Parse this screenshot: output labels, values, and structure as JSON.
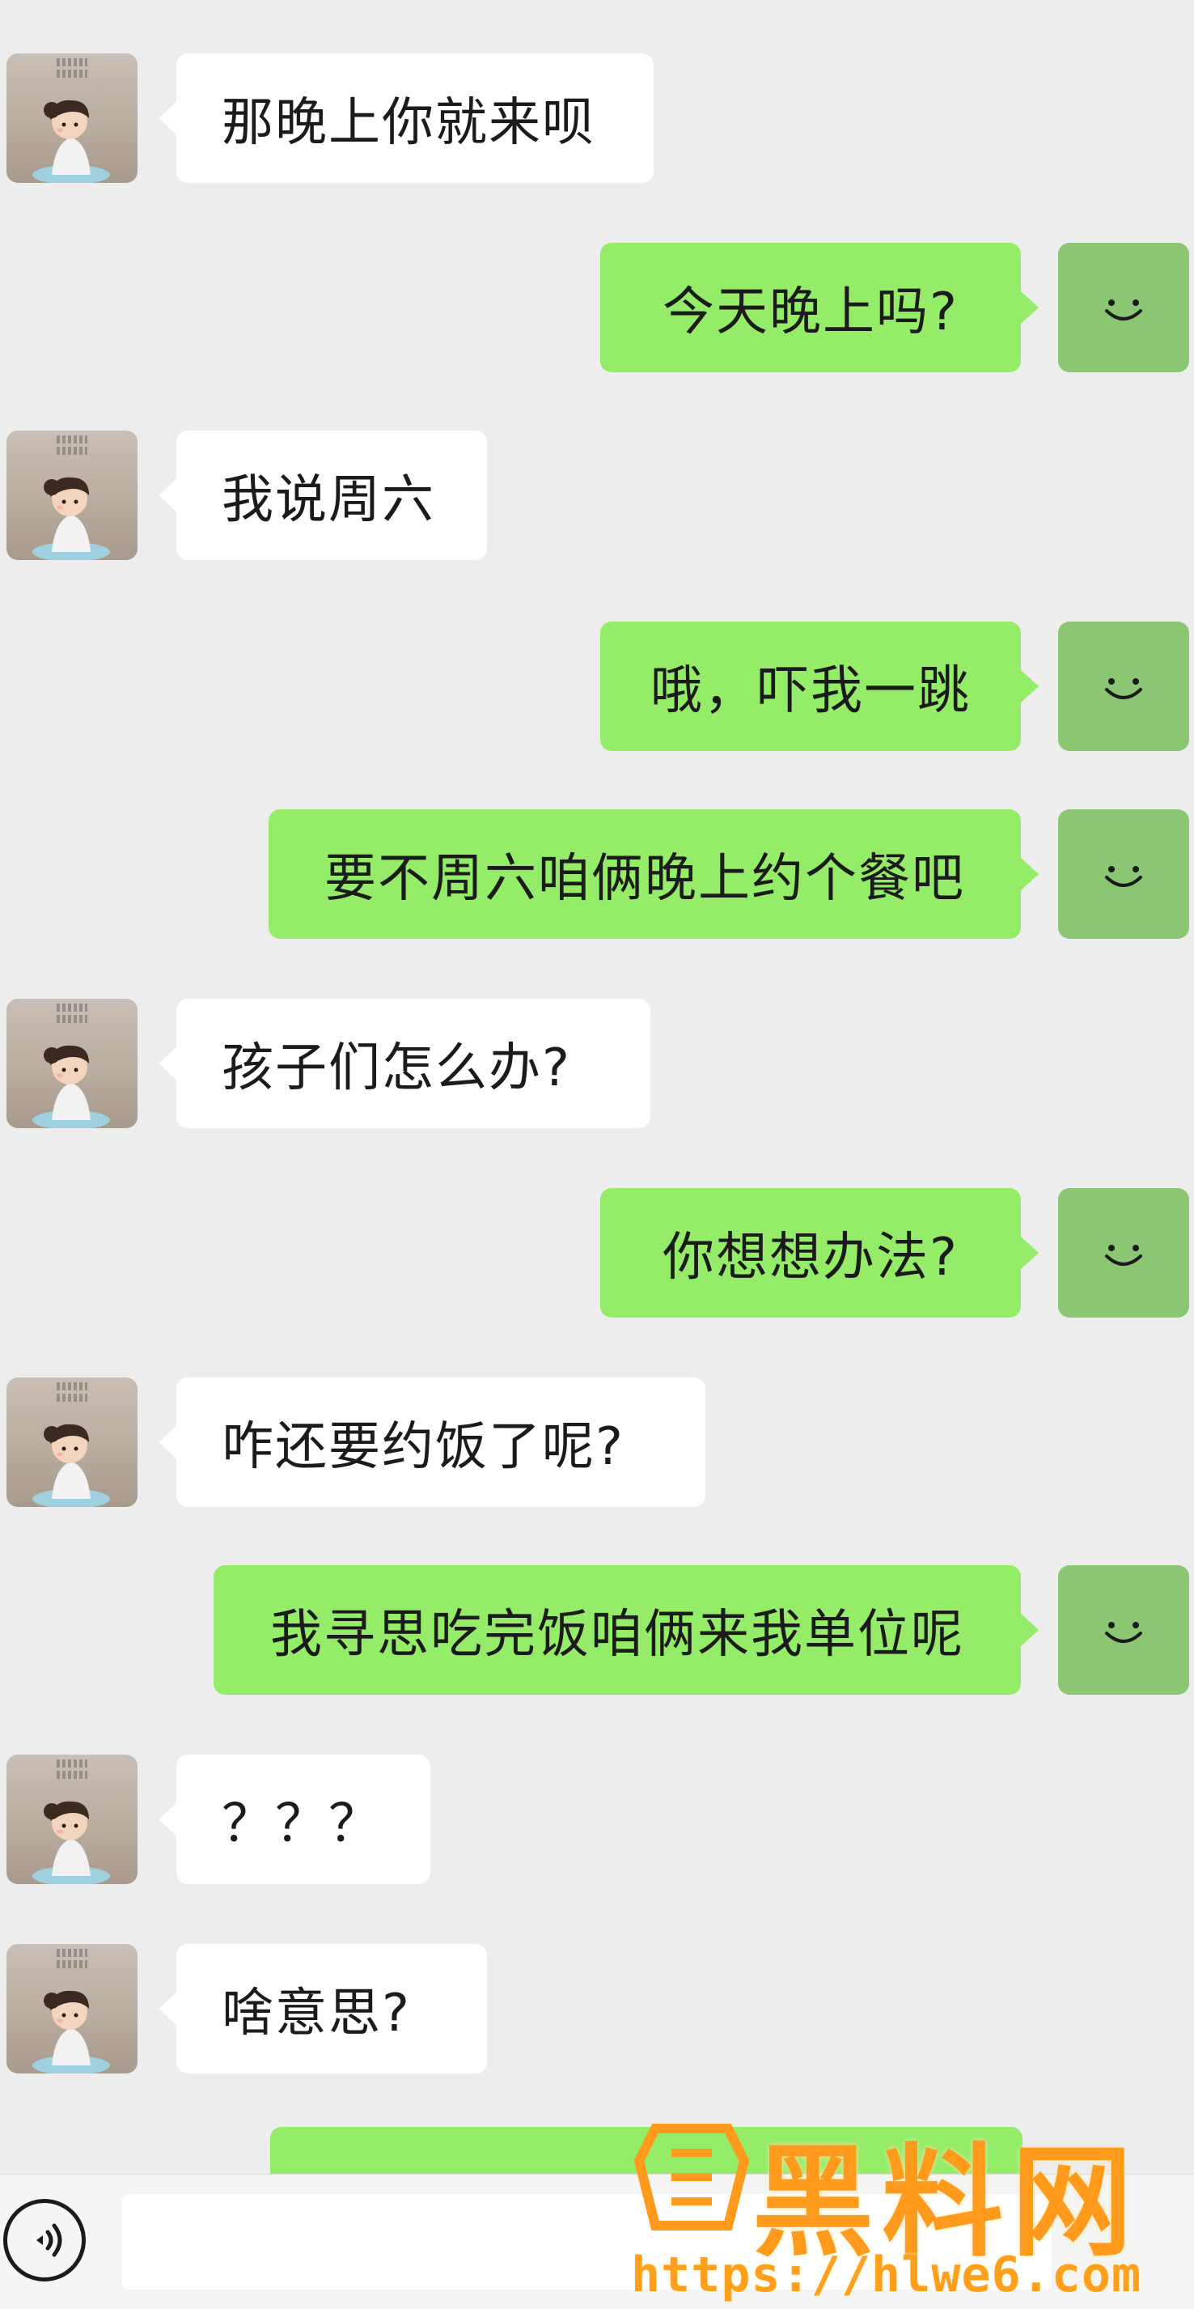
{
  "chat": {
    "messages": [
      {
        "side": "left",
        "text": "那晚上你就来呗"
      },
      {
        "side": "right",
        "text": "今天晚上吗?"
      },
      {
        "side": "left",
        "text": "我说周六"
      },
      {
        "side": "right",
        "text": "哦，吓我一跳"
      },
      {
        "side": "right",
        "text": "要不周六咱俩晚上约个餐吧"
      },
      {
        "side": "left",
        "text": "孩子们怎么办?"
      },
      {
        "side": "right",
        "text": "你想想办法?"
      },
      {
        "side": "left",
        "text": "咋还要约饭了呢?"
      },
      {
        "side": "right",
        "text": "我寻思吃完饭咱俩来我单位呢"
      },
      {
        "side": "left",
        "text": "？？？"
      },
      {
        "side": "left",
        "text": "啥意思?"
      }
    ]
  },
  "input_bar": {
    "voice_icon": "voice-wave-icon"
  },
  "watermark": {
    "title": "黑料网",
    "url": "https://hlwe6.com"
  },
  "colors": {
    "background": "#ededed",
    "incoming_bubble": "#ffffff",
    "outgoing_bubble": "#95ec69",
    "outgoing_avatar": "#8bc672",
    "watermark": "#ff9a1c"
  }
}
